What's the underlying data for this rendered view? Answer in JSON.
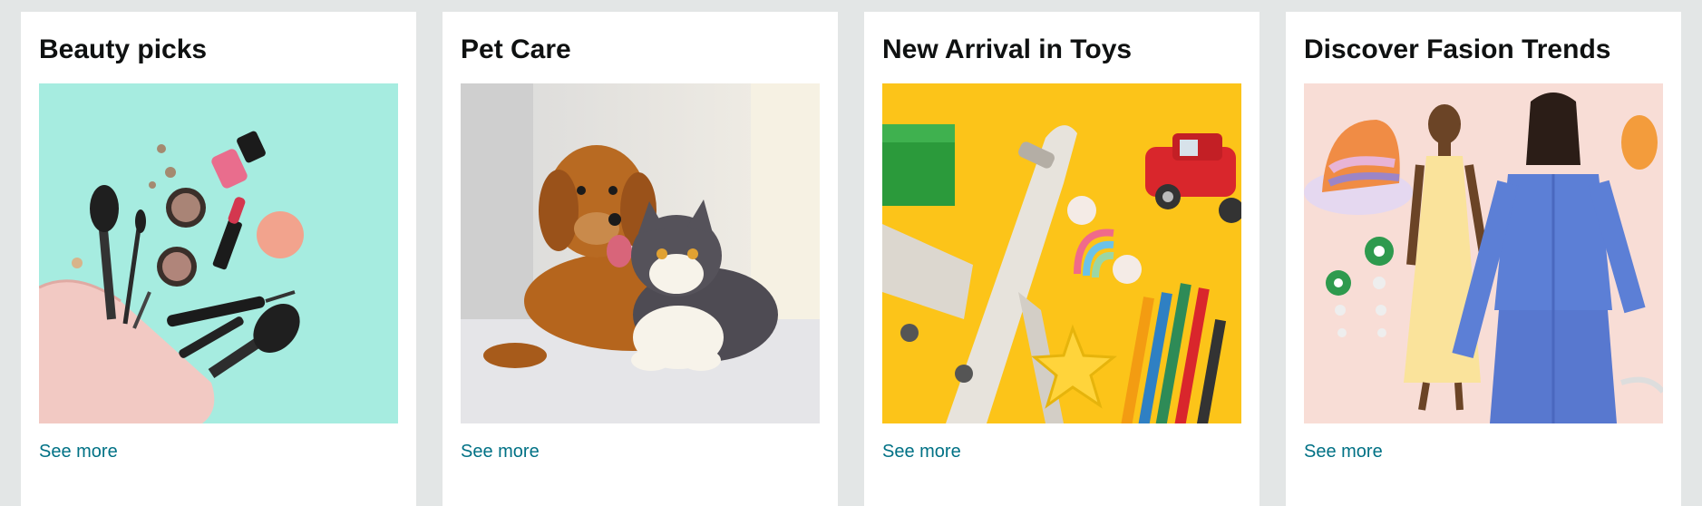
{
  "cards": [
    {
      "title": "Beauty picks",
      "link_label": "See more",
      "image": "cosmetics-bag-with-makeup-image"
    },
    {
      "title": "Pet Care",
      "link_label": "See more",
      "image": "dog-and-cat-image"
    },
    {
      "title": "New Arrival in Toys",
      "link_label": "See more",
      "image": "toy-airplane-and-car-image"
    },
    {
      "title": "Discover Fasion Trends",
      "link_label": "See more",
      "image": "fashion-models-image"
    }
  ],
  "colors": {
    "page_background": "#e3e6e6",
    "card_background": "#ffffff",
    "title_text": "#0f1111",
    "link_text": "#007185",
    "beauty_bg": "#a6ece0",
    "toys_bg": "#fcc419",
    "fashion_bg": "#f8ddd6"
  }
}
